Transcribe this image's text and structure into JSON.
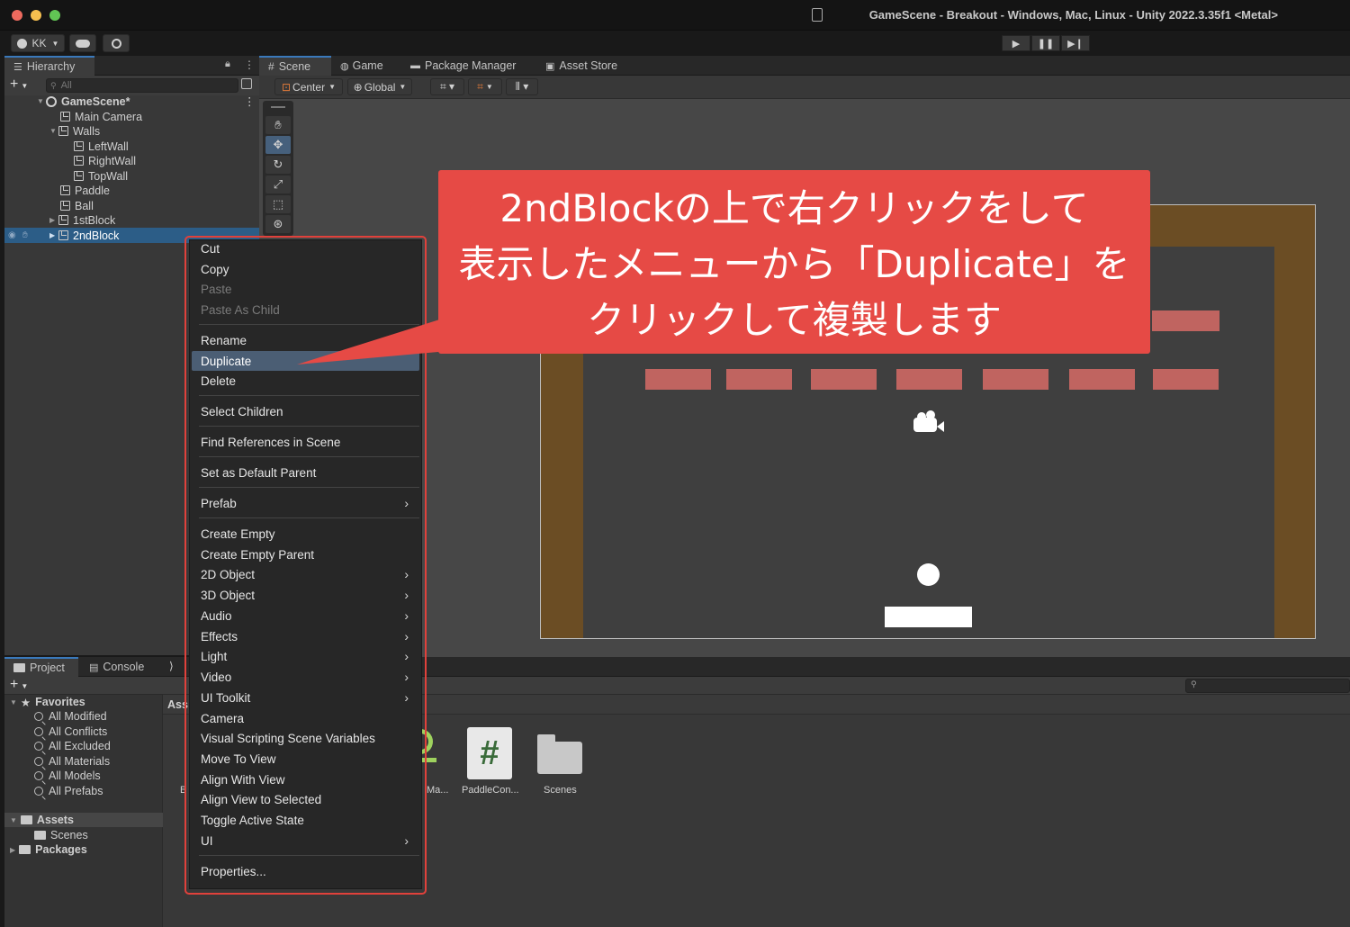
{
  "window": {
    "title": "GameScene - Breakout - Windows, Mac, Linux - Unity 2022.3.35f1 <Metal>"
  },
  "toolbar": {
    "account_label": "KK",
    "icons": [
      "account-icon",
      "cloud-icon",
      "collab-icon",
      "play-icon",
      "pause-icon",
      "step-icon"
    ]
  },
  "hierarchy": {
    "tab_label": "Hierarchy",
    "search_placeholder": "All",
    "items": [
      {
        "label": "GameScene*"
      },
      {
        "label": "Main Camera"
      },
      {
        "label": "Walls"
      },
      {
        "label": "LeftWall"
      },
      {
        "label": "RightWall"
      },
      {
        "label": "TopWall"
      },
      {
        "label": "Paddle"
      },
      {
        "label": "Ball"
      },
      {
        "label": "1stBlock"
      },
      {
        "label": "2ndBlock"
      }
    ]
  },
  "scene": {
    "tabs": [
      {
        "label": "Scene"
      },
      {
        "label": "Game"
      },
      {
        "label": "Package Manager"
      },
      {
        "label": "Asset Store"
      }
    ],
    "pivot_label": "Center",
    "space_label": "Global"
  },
  "project": {
    "tabs": [
      {
        "label": "Project"
      },
      {
        "label": "Console"
      }
    ],
    "favorites_label": "Favorites",
    "favorites": [
      {
        "label": "All Modified"
      },
      {
        "label": "All Conflicts"
      },
      {
        "label": "All Excluded"
      },
      {
        "label": "All Materials"
      },
      {
        "label": "All Models"
      },
      {
        "label": "All Prefabs"
      }
    ],
    "assets_label": "Assets",
    "scenes_label": "Scenes",
    "packages_label": "Packages",
    "breadcrumb_partial": "Ass",
    "asset_items": [
      {
        "label": "Ma..."
      },
      {
        "label": "PaddleCon..."
      },
      {
        "label": "Scenes"
      }
    ],
    "partial_left_label": "B"
  },
  "context_menu": {
    "items": [
      {
        "label": "Cut",
        "enabled": true
      },
      {
        "label": "Copy",
        "enabled": true
      },
      {
        "label": "Paste",
        "enabled": false
      },
      {
        "label": "Paste As Child",
        "enabled": false
      },
      {
        "label": "Rename",
        "enabled": true
      },
      {
        "label": "Duplicate",
        "enabled": true,
        "highlighted": true
      },
      {
        "label": "Delete",
        "enabled": true
      },
      {
        "label": "Select Children",
        "enabled": true
      },
      {
        "label": "Find References in Scene",
        "enabled": true
      },
      {
        "label": "Set as Default Parent",
        "enabled": true
      },
      {
        "label": "Prefab",
        "submenu": true
      },
      {
        "label": "Create Empty",
        "enabled": true
      },
      {
        "label": "Create Empty Parent",
        "enabled": true
      },
      {
        "label": "2D Object",
        "submenu": true
      },
      {
        "label": "3D Object",
        "submenu": true
      },
      {
        "label": "Audio",
        "submenu": true
      },
      {
        "label": "Effects",
        "submenu": true
      },
      {
        "label": "Light",
        "submenu": true
      },
      {
        "label": "Video",
        "submenu": true
      },
      {
        "label": "UI Toolkit",
        "submenu": true
      },
      {
        "label": "Camera",
        "enabled": true
      },
      {
        "label": "Visual Scripting Scene Variables",
        "enabled": true
      },
      {
        "label": "Move To View",
        "enabled": true
      },
      {
        "label": "Align With View",
        "enabled": true
      },
      {
        "label": "Align View to Selected",
        "enabled": true
      },
      {
        "label": "Toggle Active State",
        "enabled": true
      },
      {
        "label": "UI",
        "submenu": true
      },
      {
        "label": "Properties...",
        "enabled": true
      }
    ]
  },
  "callout": {
    "lines": [
      "2ndBlockの上で右クリックをして",
      "表示したメニューから「Duplicate」を",
      "クリックして複製します"
    ]
  },
  "colors": {
    "callout": "#e64a45",
    "selection": "#2c5d87",
    "brick": "#c06460",
    "wall": "#6b4d24"
  }
}
